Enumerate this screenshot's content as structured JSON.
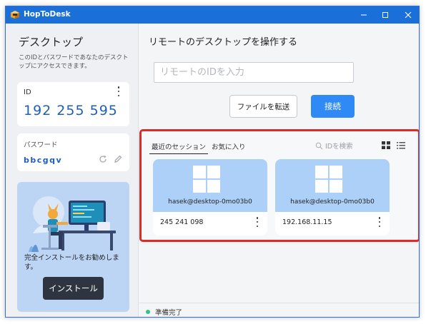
{
  "window": {
    "title": "HopToDesk",
    "app_icon": "hoptodesk-logo-icon",
    "controls": [
      "minimize-icon",
      "maximize-icon",
      "close-icon"
    ]
  },
  "sidebar": {
    "title": "デスクトップ",
    "description": "このIDとパスワードであなたのデスクトップにアクセスできます。",
    "id_card": {
      "label": "ID",
      "value": "192 255 595",
      "menu_icon": "more-vertical-icon"
    },
    "password_card": {
      "label": "パスワード",
      "value": "bbcgqv",
      "refresh_icon": "refresh-icon",
      "edit_icon": "pencil-icon"
    },
    "install_card": {
      "text": "完全インストールをお勧めします。",
      "button_label": "インストール",
      "illustration": "person-at-computer-illustration"
    }
  },
  "main": {
    "title": "リモートのデスクトップを操作する",
    "id_input": {
      "placeholder": "リモートのIDを入力",
      "value": ""
    },
    "transfer_button": "ファイルを転送",
    "connect_button": "接続",
    "sessions": {
      "tabs": [
        {
          "label": "最近のセッション",
          "active": true
        },
        {
          "label": "お気に入り",
          "active": false
        }
      ],
      "search_placeholder": "IDを検索",
      "view_icons": [
        "grid-view-icon",
        "list-view-icon"
      ],
      "items": [
        {
          "user": "hasek@desktop-0mo03b0",
          "id": "245 241 098",
          "os_icon": "windows-logo-icon"
        },
        {
          "user": "hasek@desktop-0mo03b0",
          "id": "192.168.11.15",
          "os_icon": "windows-logo-icon"
        }
      ]
    }
  },
  "status": {
    "text": "準備完了",
    "color": "#37c08a"
  },
  "colors": {
    "titlebar": "#1b6fd8",
    "accent": "#2f8af5",
    "id_text": "#1f5fb8",
    "highlight": "#e02a2a",
    "thumb": "#acd0f8"
  }
}
